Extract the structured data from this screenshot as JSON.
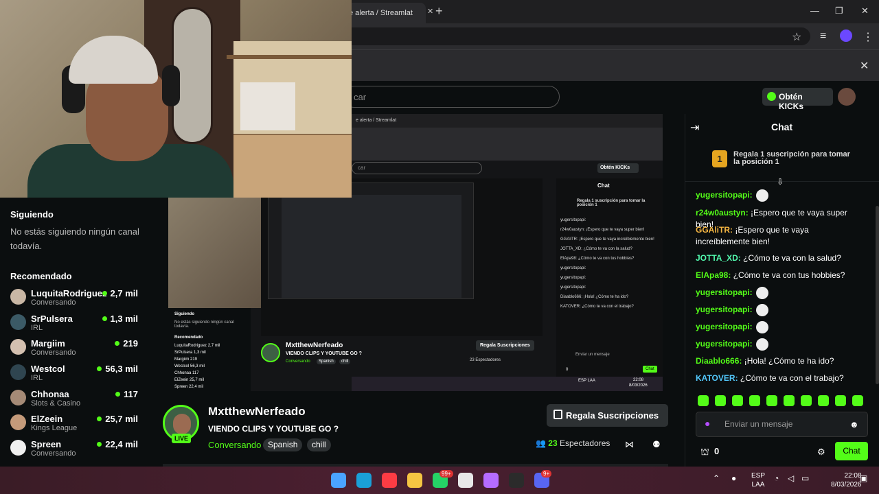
{
  "browser": {
    "tab_title": "e alerta / Streamlat",
    "tab_close": "✕",
    "new_tab": "+",
    "window_controls": [
      "—",
      "❐",
      "✕"
    ],
    "toolbar_icons": [
      "☆",
      "≡",
      ""
    ],
    "infobar_close": "✕"
  },
  "header": {
    "search_placeholder": "car",
    "kicks_button": "Obtén KICKs"
  },
  "sidebar": {
    "following_title": "Siguiendo",
    "following_empty": "No estás siguiendo ningún canal todavía.",
    "recommended_title": "Recomendado",
    "channels": [
      {
        "name": "LuquitaRodriguez",
        "category": "Conversando",
        "viewers": "2,7 mil",
        "avatar_color": "#c9b7a5"
      },
      {
        "name": "SrPulsera",
        "category": "IRL",
        "viewers": "1,3 mil",
        "avatar_color": "#3b5a66"
      },
      {
        "name": "Margiim",
        "category": "Conversando",
        "viewers": "219",
        "avatar_color": "#d4c0b0"
      },
      {
        "name": "Westcol",
        "category": "IRL",
        "viewers": "56,3 mil",
        "avatar_color": "#2f4550"
      },
      {
        "name": "Chhonaa",
        "category": "Slots & Casino",
        "viewers": "117",
        "avatar_color": "#a58a76"
      },
      {
        "name": "ElZeein",
        "category": "Kings League",
        "viewers": "25,7 mil",
        "avatar_color": "#c49a7a"
      },
      {
        "name": "Spreen",
        "category": "Conversando",
        "viewers": "22,4 mil",
        "avatar_color": "#f0f0f0"
      }
    ]
  },
  "nested": {
    "tab_text": "e alerta / Streamlat",
    "search": "car",
    "kicks": "Obtén KICKs",
    "sidebar_following": "Siguiendo",
    "sidebar_empty": "No estás siguiendo ningún canal todavía.",
    "sidebar_rec": "Recomendado",
    "sidebar_channels": [
      "LuquitaRodriguez 2,7 mil",
      "SrPulsera 1,3 mil",
      "Margiim 219",
      "Westcol 56,3 mil",
      "Chhonaa 117",
      "ElZeein 25,7 mil",
      "Spreen 22,4 mil"
    ],
    "streamer": "MxtthewNerfeado",
    "title": "VIENDO CLIPS Y YOUTUBE GO ?",
    "category": "Conversando",
    "tags": [
      "Spanish",
      "chill"
    ],
    "gift": "Regala Suscripciones",
    "viewers": "23 Espectadores",
    "chat_title": "Chat",
    "chat_pin": "Regala 1 suscripción para tomar la posición 1",
    "chat_lines": [
      "yugersitopapi:",
      "r24w0austyn: ¡Espero que te vaya super bien!",
      "GGAliTR: ¡Espero que te vaya increíblemente bien!",
      "JOTTA_XD: ¿Cómo te va con la salud?",
      "ElApa98: ¿Cómo te va con tus hobbies?",
      "yugersitopapi:",
      "yugersitopapi:",
      "yugersitopapi:",
      "Diaablo666: ¡Hola! ¿Cómo te ha ido?",
      "KATOVER: ¿Cómo te va con el trabajo?"
    ],
    "input": "Enviar un mensaje",
    "points": "0",
    "chat_btn": "Chat",
    "clock_time": "22:08",
    "clock_date": "8/03/2026",
    "lang": "ESP LAA"
  },
  "stream": {
    "streamer": "MxtthewNerfeado",
    "live": "LIVE",
    "title": "VIENDO CLIPS Y YOUTUBE GO ?",
    "category": "Conversando",
    "tags": [
      "Spanish",
      "chill"
    ],
    "gift_button": "Regala Suscripciones",
    "viewer_count": "23",
    "viewer_label": "Espectadores"
  },
  "chat": {
    "title": "Chat",
    "pinned_position": "1",
    "pinned_text": "Regala 1 suscripción para tomar la posición 1",
    "messages": [
      {
        "user": "yugersitopapi:",
        "text": "",
        "color": "#53fc18",
        "emote": true
      },
      {
        "user": "r24w0austyn:",
        "text": "¡Espero que te vaya super bien!",
        "color": "#53fc18",
        "emote": false
      },
      {
        "user": "GGAliTR:",
        "text": "¡Espero que te vaya increíblemente bien!",
        "color": "#f5b642",
        "emote": false
      },
      {
        "user": "JOTTA_XD:",
        "text": "¿Cómo te va con la salud?",
        "color": "#53fcb0",
        "emote": false
      },
      {
        "user": "ElApa98:",
        "text": "¿Cómo te va con tus hobbies?",
        "color": "#53fc18",
        "emote": false
      },
      {
        "user": "yugersitopapi:",
        "text": "",
        "color": "#53fc18",
        "emote": true
      },
      {
        "user": "yugersitopapi:",
        "text": "",
        "color": "#53fc18",
        "emote": true
      },
      {
        "user": "yugersitopapi:",
        "text": "",
        "color": "#53fc18",
        "emote": true
      },
      {
        "user": "yugersitopapi:",
        "text": "",
        "color": "#53fc18",
        "emote": true
      },
      {
        "user": "Diaablo666:",
        "text": "¡Hola! ¿Cómo te ha ido?",
        "color": "#53fc18",
        "emote": false
      },
      {
        "user": "KATOVER:",
        "text": "¿Cómo te va con el trabajo?",
        "color": "#53c8fc",
        "emote": false
      }
    ],
    "input_placeholder": "Enviar un mensaje",
    "points": "0",
    "send_button": "Chat"
  },
  "taskbar": {
    "apps": [
      {
        "name": "start",
        "color": "#4aa3ff"
      },
      {
        "name": "edge",
        "color": "#1aa0d8"
      },
      {
        "name": "music",
        "color": "#fc3c44"
      },
      {
        "name": "files",
        "color": "#f5c542"
      },
      {
        "name": "whatsapp",
        "color": "#25d366",
        "badge": "99+"
      },
      {
        "name": "chrome",
        "color": "#e8e8e8"
      },
      {
        "name": "copilot",
        "color": "#b56cff"
      },
      {
        "name": "obs",
        "color": "#2b2b2b"
      },
      {
        "name": "discord",
        "color": "#5865f2",
        "badge": "9+"
      }
    ],
    "lang_top": "ESP",
    "lang_bottom": "LAA",
    "time": "22:08",
    "date": "8/03/2026"
  },
  "colors": {
    "kick_green": "#53fc18",
    "background": "#0b0e0f",
    "button_bg": "#2d3133",
    "pin_gold": "#e6a520"
  }
}
